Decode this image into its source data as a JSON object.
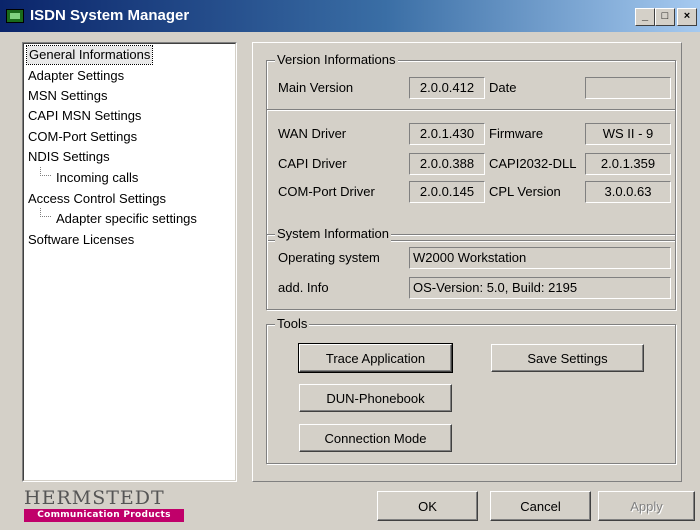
{
  "window": {
    "title": "ISDN System Manager"
  },
  "tree": {
    "items": [
      {
        "label": "General Informations",
        "selected": true
      },
      {
        "label": "Adapter Settings"
      },
      {
        "label": "MSN Settings"
      },
      {
        "label": "CAPI MSN Settings"
      },
      {
        "label": "COM-Port Settings"
      },
      {
        "label": "NDIS Settings"
      },
      {
        "label": "Incoming calls",
        "child": true
      },
      {
        "label": "Access Control Settings"
      },
      {
        "label": "Adapter specific settings",
        "child": true
      },
      {
        "label": "Software Licenses"
      }
    ]
  },
  "version": {
    "title": "Version Informations",
    "main_version_label": "Main Version",
    "main_version": "2.0.0.412",
    "date_label": "Date",
    "date": "",
    "wan_label": "WAN Driver",
    "wan": "2.0.1.430",
    "firmware_label": "Firmware",
    "firmware": "WS II - 9",
    "capi_label": "CAPI Driver",
    "capi": "2.0.0.388",
    "capi2032_label": "CAPI2032-DLL",
    "capi2032": "2.0.1.359",
    "com_label": "COM-Port Driver",
    "com": "2.0.0.145",
    "cpl_label": "CPL Version",
    "cpl": "3.0.0.63"
  },
  "system": {
    "title": "System Information",
    "os_label": "Operating system",
    "os": "W2000 Workstation",
    "info_label": "add. Info",
    "info": "OS-Version: 5.0, Build: 2195"
  },
  "tools": {
    "title": "Tools",
    "trace": "Trace Application",
    "save": "Save Settings",
    "dun": "DUN-Phonebook",
    "connection": "Connection Mode"
  },
  "footer": {
    "logo_name": "HERMSTEDT",
    "logo_sub": "Communication Products",
    "ok": "OK",
    "cancel": "Cancel",
    "apply": "Apply"
  },
  "colors": {
    "title_start": "#0a246a",
    "title_end": "#a6caf0",
    "logo_bar": "#c0006a"
  },
  "icons": {
    "app": "isdn-app-icon",
    "minimize": "minimize-icon",
    "maximize": "maximize-icon",
    "close": "close-icon"
  }
}
